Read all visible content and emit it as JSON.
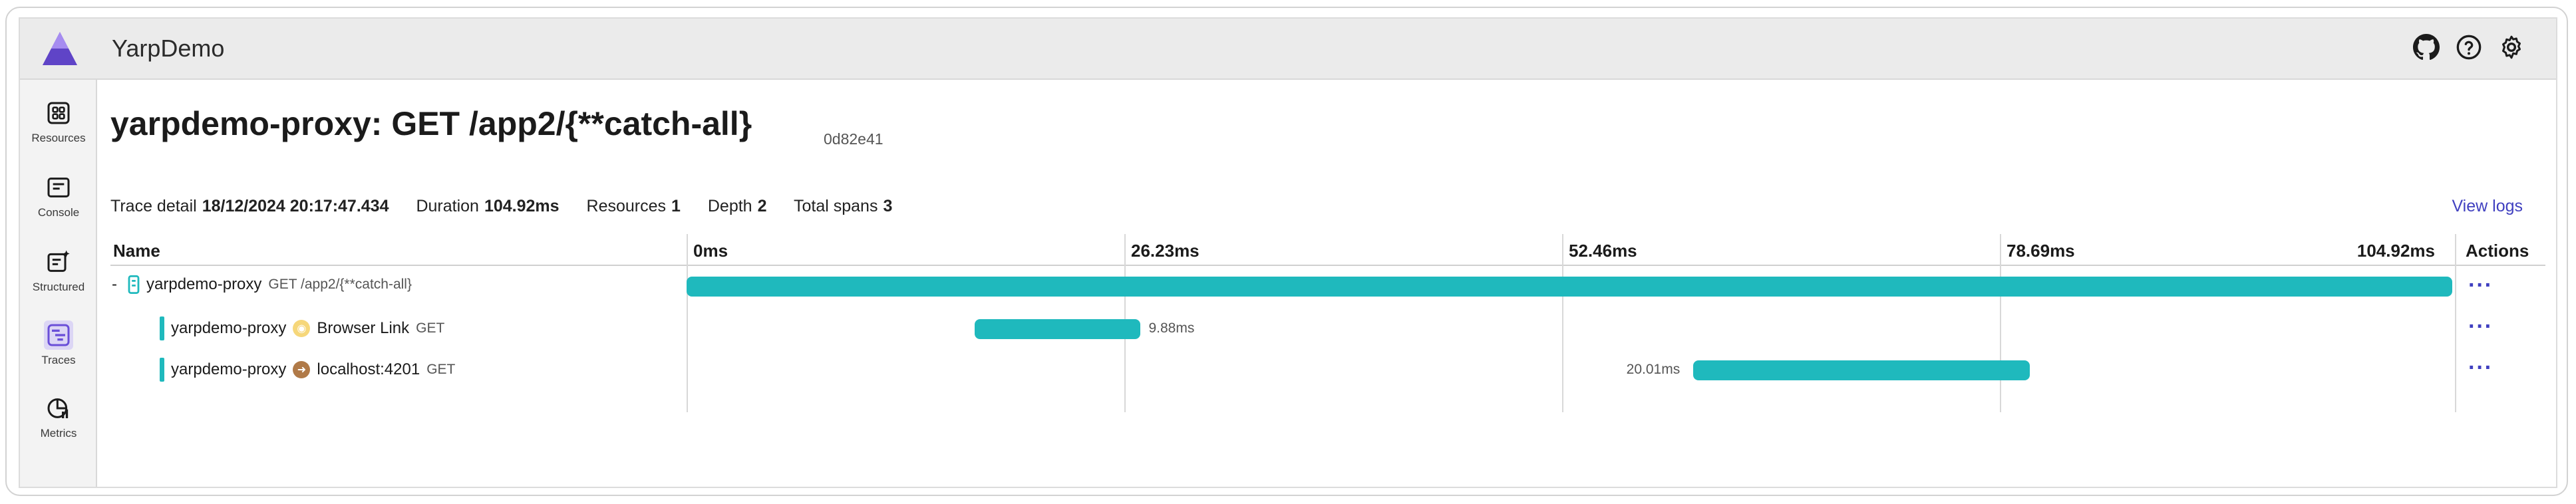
{
  "app": {
    "title": "YarpDemo"
  },
  "topbar": {
    "icons": [
      "github-icon",
      "help-icon",
      "settings-icon"
    ]
  },
  "sidebar": {
    "items": [
      {
        "label": "Resources",
        "icon": "resources-icon",
        "active": false
      },
      {
        "label": "Console",
        "icon": "console-icon",
        "active": false
      },
      {
        "label": "Structured",
        "icon": "structured-icon",
        "active": false
      },
      {
        "label": "Traces",
        "icon": "traces-icon",
        "active": true
      },
      {
        "label": "Metrics",
        "icon": "metrics-icon",
        "active": false
      }
    ]
  },
  "page": {
    "title": "yarpdemo-proxy: GET /app2/{**catch-all}",
    "trace_id": "0d82e41"
  },
  "summary": {
    "trace_detail_label": "Trace detail",
    "trace_detail_value": "18/12/2024 20:17:47.434",
    "duration_label": "Duration",
    "duration_value": "104.92ms",
    "resources_label": "Resources",
    "resources_value": "1",
    "depth_label": "Depth",
    "depth_value": "2",
    "total_spans_label": "Total spans",
    "total_spans_value": "3",
    "view_logs": "View logs"
  },
  "table": {
    "headers": {
      "name": "Name",
      "actions": "Actions",
      "ticks": [
        "0ms",
        "26.23ms",
        "52.46ms",
        "78.69ms",
        "104.92ms"
      ]
    },
    "total_ms": 104.92,
    "rows": [
      {
        "toggle": "-",
        "service": "yarpdemo-proxy",
        "detail": "GET /app2/{**catch-all}",
        "peer": "",
        "method": "",
        "start_ms": 0,
        "duration_ms": 104.92,
        "duration_label": "",
        "actions": "···"
      },
      {
        "toggle": "",
        "service": "yarpdemo-proxy",
        "detail": "",
        "peer": "Browser Link",
        "method": "GET",
        "start_ms": 17.1,
        "duration_ms": 9.88,
        "duration_label": "9.88ms",
        "actions": "···"
      },
      {
        "toggle": "",
        "service": "yarpdemo-proxy",
        "detail": "",
        "peer": "localhost:4201",
        "method": "GET",
        "start_ms": 59.8,
        "duration_ms": 20.01,
        "duration_label": "20.01ms",
        "actions": "···"
      }
    ]
  },
  "colors": {
    "accent": "#1fb9bd",
    "link": "#4040c0",
    "nav_active": "#dcd6f5"
  }
}
